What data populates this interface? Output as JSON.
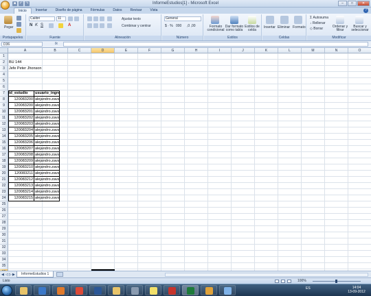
{
  "window": {
    "title": "InformeEstudios[1] - Microsoft Excel"
  },
  "qat": {
    "icons": [
      "save-icon",
      "undo-icon",
      "redo-icon"
    ]
  },
  "tabs": [
    "Inicio",
    "Insertar",
    "Diseño de página",
    "Fórmulas",
    "Datos",
    "Revisar",
    "Vista"
  ],
  "ribbon": {
    "clipboard": {
      "paste": "Pegar",
      "label": "Portapapeles"
    },
    "font": {
      "name": "Calibri",
      "size": "11",
      "label": "Fuente"
    },
    "alignment": {
      "wrap": "Ajustar texto",
      "merge": "Combinar y centrar",
      "label": "Alineación"
    },
    "number": {
      "format": "General",
      "label": "Número"
    },
    "styles": {
      "cond": "Formato condicional",
      "table": "Dar formato como tabla",
      "cell": "Estilos de celda",
      "label": "Estilos"
    },
    "cells": {
      "insert": "Insertar",
      "delete": "Eliminar",
      "format": "Formato",
      "label": "Celdas"
    },
    "editing": {
      "autosum": "Autosuma",
      "fill": "Rellenar",
      "clear": "Borrar",
      "sort": "Ordenar y filtrar",
      "find": "Buscar y seleccionar",
      "label": "Modificar"
    }
  },
  "formula_bar": {
    "name_box": "D36",
    "fx": "fx",
    "formula": ""
  },
  "columns": [
    "A",
    "B",
    "C",
    "D",
    "E",
    "F",
    "G",
    "H",
    "I",
    "J",
    "K",
    "L",
    "M",
    "N",
    "O"
  ],
  "selected_column": "D",
  "selected_row": "36",
  "rows": [
    "1",
    "2",
    "3",
    "4",
    "5",
    "6",
    "7",
    "8",
    "9",
    "10",
    "11",
    "12",
    "13",
    "14",
    "15",
    "16",
    "17",
    "18",
    "19",
    "20",
    "21",
    "22",
    "23",
    "24",
    "25",
    "26",
    "27",
    "28",
    "29",
    "30",
    "31",
    "32",
    "33",
    "34",
    "35",
    "36",
    "37"
  ],
  "sheet": {
    "a2": "BU 144",
    "a3": "Jefe Peter Jhonson",
    "headers": [
      "id_estudio",
      "usuario_ingreso"
    ],
    "records": [
      [
        "120083200",
        "alejandro.zavala"
      ],
      [
        "120083200",
        "alejandro.zavala"
      ],
      [
        "120083201",
        "alejandro.zavala"
      ],
      [
        "120083202",
        "alejandro.zavala"
      ],
      [
        "120083203",
        "alejandro.zavala"
      ],
      [
        "120083204",
        "alejandro.zavala"
      ],
      [
        "120083205",
        "alejandro.zavala"
      ],
      [
        "120083206",
        "alejandro.zavala"
      ],
      [
        "120083207",
        "alejandro.zavala"
      ],
      [
        "120083208",
        "alejandro.zavala"
      ],
      [
        "120083209",
        "alejandro.zavala"
      ],
      [
        "120083210",
        "alejandro.zavala"
      ],
      [
        "120083211",
        "alejandro.zavala"
      ],
      [
        "120083212",
        "alejandro.zavala"
      ],
      [
        "120083213",
        "alejandro.zavala"
      ],
      [
        "120083214",
        "alejandro.zavala"
      ],
      [
        "120083215",
        "alejandro.zavala"
      ]
    ]
  },
  "sheet_tabs": {
    "active": "InformeEstudios 1"
  },
  "status": {
    "text": "Listo",
    "zoom": "100%"
  },
  "taskbar": {
    "apps": [
      "explorer-icon",
      "ie-icon",
      "media-icon",
      "chrome-icon",
      "word-icon",
      "folder-icon",
      "calculator-icon",
      "sticky-icon",
      "acrobat-icon",
      "excel-icon",
      "outlook-icon",
      "paint-icon"
    ],
    "lang": "ES",
    "time": "14:04",
    "date": "13-09-2012"
  }
}
